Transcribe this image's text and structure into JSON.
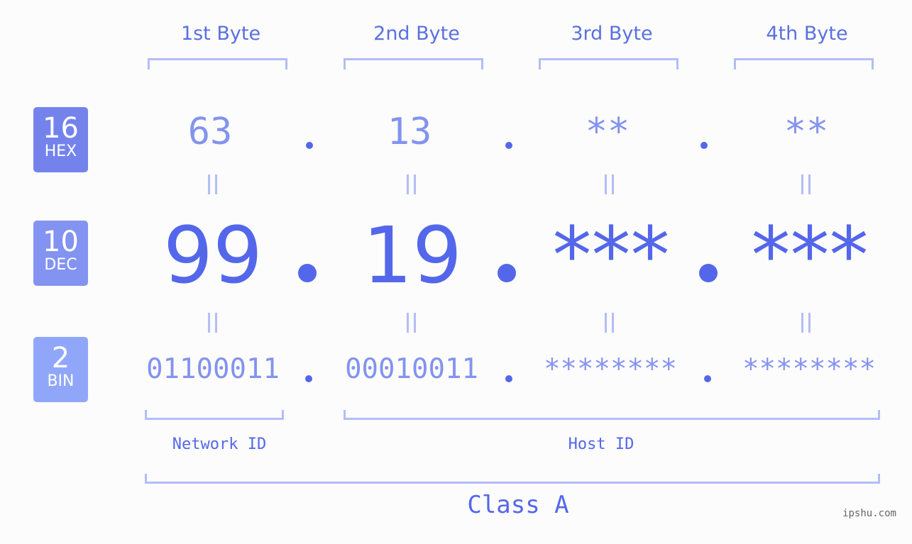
{
  "byte_headers": [
    "1st Byte",
    "2nd Byte",
    "3rd Byte",
    "4th Byte"
  ],
  "badges": {
    "hex": {
      "number": "16",
      "label": "HEX",
      "color": "#7483ec"
    },
    "dec": {
      "number": "10",
      "label": "DEC",
      "color": "#8393f1"
    },
    "bin": {
      "number": "2",
      "label": "BIN",
      "color": "#90a7f9"
    }
  },
  "hex_values": [
    "63",
    "13",
    "**",
    "**"
  ],
  "dec_values": [
    "99",
    "19",
    "***",
    "***"
  ],
  "bin_values": [
    "01100011",
    "00010011",
    "********",
    "********"
  ],
  "separator": ".",
  "equals": "=",
  "network_id_label": "Network ID",
  "host_id_label": "Host ID",
  "class_label": "Class A",
  "watermark": "ipshu.com"
}
